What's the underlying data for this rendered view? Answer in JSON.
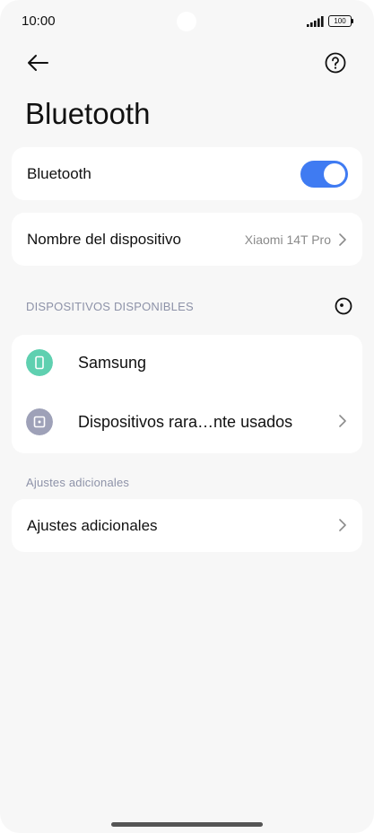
{
  "status_bar": {
    "time": "10:00",
    "battery": "100"
  },
  "header": {
    "title": "Bluetooth"
  },
  "bluetooth": {
    "label": "Bluetooth",
    "enabled": true
  },
  "device_name": {
    "label": "Nombre del dispositivo",
    "value": "Xiaomi 14T Pro"
  },
  "available": {
    "header": "DISPOSITIVOS DISPONIBLES",
    "devices": [
      {
        "label": "Samsung",
        "icon": "phone-device-icon",
        "icon_color": "#5fd0b0"
      },
      {
        "label": "Dispositivos rara…nte usados",
        "icon": "rarely-used-devices-icon",
        "icon_color": "#9ea1b8"
      }
    ]
  },
  "additional": {
    "header": "Ajustes adicionales",
    "label": "Ajustes adicionales"
  },
  "colors": {
    "accent": "#3f7bf2",
    "background": "#f7f7f7",
    "card": "#ffffff",
    "section_header": "#8d92a8"
  }
}
